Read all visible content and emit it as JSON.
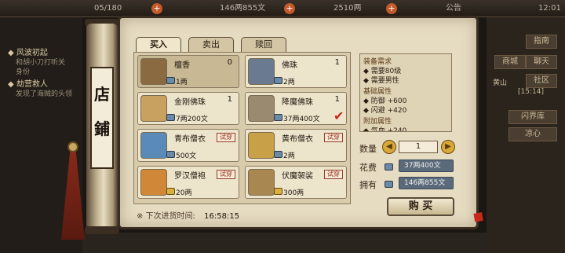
{
  "topbar": {
    "res1": "05/180",
    "res2": "146两855文",
    "res3": "2510两",
    "notice": "公告",
    "time": "12:01"
  },
  "left_panel": {
    "quest1_title": "◆ 风波初起",
    "quest1_desc1": "和胡小刀打听关",
    "quest1_desc2": "身份",
    "quest2_title": "◆ 劫营救人",
    "quest2_desc": "发现了海贼的头领"
  },
  "right_panel": {
    "btn_a": "指南",
    "btn_b": "聊天",
    "btn_c": "商城",
    "btn_d": "社区",
    "location": "黄山",
    "time": "[15:14]",
    "side1": "闪界库",
    "side2": "凉心"
  },
  "shop": {
    "sign": "店\n\n鋪",
    "tabs": [
      "买入",
      "卖出",
      "赎回"
    ],
    "items": [
      {
        "name": "檀香",
        "count": "0",
        "price": "1两"
      },
      {
        "name": "佛珠",
        "count": "1",
        "price": "2两"
      },
      {
        "name": "金刚佛珠",
        "count": "1",
        "price": "7两200文"
      },
      {
        "name": "降魔佛珠",
        "count": "1",
        "price": "37两400文"
      },
      {
        "name": "青布僧衣",
        "try": "试穿",
        "price": "500文"
      },
      {
        "name": "黄布僧衣",
        "try": "试穿",
        "price": "2两"
      },
      {
        "name": "罗汉僧袍",
        "try": "试穿",
        "price": "20两"
      },
      {
        "name": "伏魔袈裟",
        "try": "试穿",
        "price": "300两"
      }
    ],
    "restock_label": "※ 下次进货时间:",
    "restock_time": "16:58:15"
  },
  "detail": {
    "req_title": "装备需求",
    "req1": "◆ 需要80级",
    "req2": "◆ 需要男性",
    "base_title": "基础属性",
    "base1": "◆ 防御 +600",
    "base2": "◆ 闪避 +420",
    "extra_title": "附加属性",
    "extra1": "◆ 气血 +240"
  },
  "purchase": {
    "qty_label": "数量",
    "qty_value": "1",
    "cost_label": "花费",
    "cost_value": "37两400文",
    "own_label": "拥有",
    "own_value": "146两855文",
    "buy_label": "购 买"
  },
  "colors": {
    "accent_red": "#c8281a",
    "parchment": "#e6dcc2",
    "coin_blue": "#5a6a7a"
  }
}
